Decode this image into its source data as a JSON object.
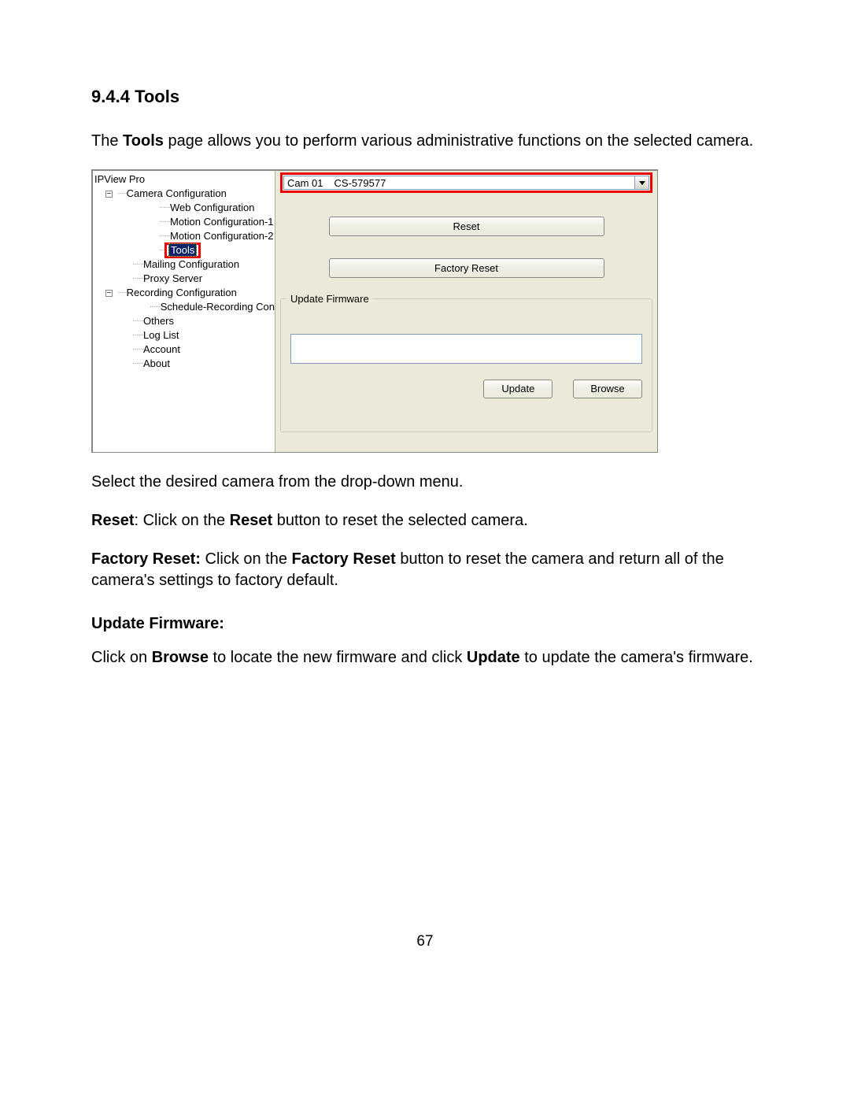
{
  "section": {
    "number": "9.4.4",
    "title": "Tools"
  },
  "intro": "The Tools page allows you to perform various administrative functions on the selected camera.",
  "screenshot": {
    "tree": {
      "root": "IPView Pro",
      "camera_config": "Camera Configuration",
      "web_config": "Web Configuration",
      "motion1": "Motion Configuration-1",
      "motion2": "Motion Configuration-2",
      "tools": "Tools",
      "mailing": "Mailing Configuration",
      "proxy": "Proxy Server",
      "recording": "Recording Configuration",
      "schedule": "Schedule-Recording Con",
      "others": "Others",
      "loglist": "Log List",
      "account": "Account",
      "about": "About"
    },
    "combo": {
      "cam": "Cam 01",
      "model": "CS-579577"
    },
    "buttons": {
      "reset": "Reset",
      "factory": "Factory Reset",
      "update": "Update",
      "browse": "Browse"
    },
    "groupbox": "Update Firmware"
  },
  "after": {
    "select_line": "Select the desired camera from the drop-down menu.",
    "reset_bold": "Reset",
    "reset_rest_a": ": Click on the ",
    "reset_b": "Reset",
    "reset_rest_b": " button to reset the selected camera.",
    "factory_bold": "Factory Reset:",
    "factory_rest_a": " Click on the ",
    "factory_b": "Factory Reset",
    "factory_rest_b": " button to reset the camera and return all of the camera's settings to factory default.",
    "subhead": "Update Firmware:",
    "browse_a": "Click on ",
    "browse_b": "Browse",
    "browse_c": " to locate the new firmware and click ",
    "browse_d": "Update",
    "browse_e": " to update the camera's firmware."
  },
  "page_num": "67"
}
